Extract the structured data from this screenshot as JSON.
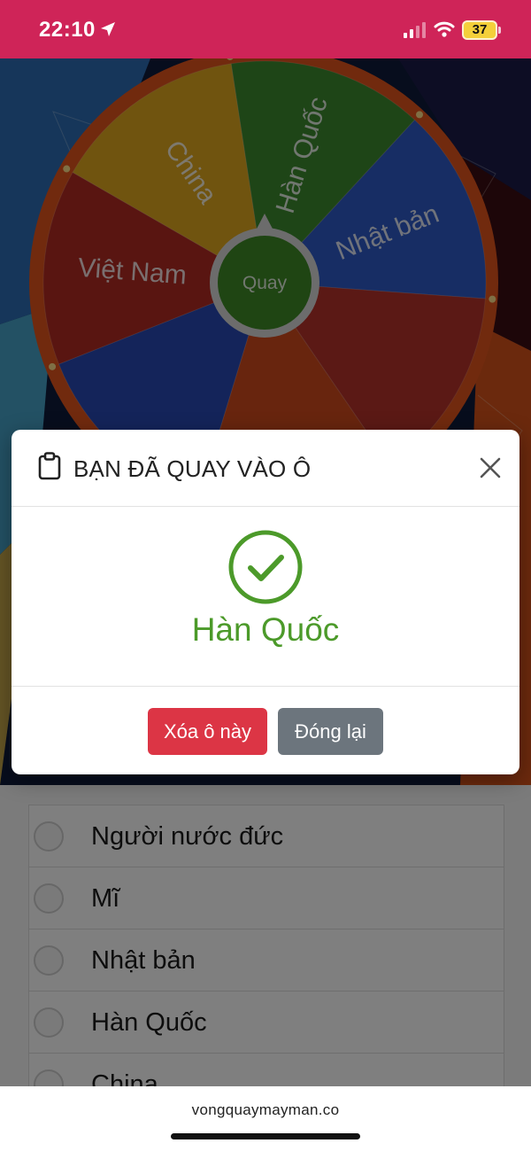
{
  "status_bar": {
    "time": "22:10",
    "location_icon": "location-arrow-icon",
    "signal_icon": "cellular-signal-icon",
    "wifi_icon": "wifi-icon",
    "battery_level": "37",
    "bar_color": "#cf2458"
  },
  "wheel": {
    "center_label": "Quay",
    "center_color": "#3f8a27",
    "pointer_icon": "pointer-triangle-icon",
    "segments": [
      {
        "label": "Hàn Quốc",
        "color": "#3d8b2f"
      },
      {
        "label": "Nhật bản",
        "color": "#2e5bc9"
      },
      {
        "label": "",
        "color": "#b7322a"
      },
      {
        "label": "",
        "color": "#d04a1c"
      },
      {
        "label": "",
        "color": "#2848b4"
      },
      {
        "label": "Việt Nam",
        "color": "#b22a22"
      },
      {
        "label": "China",
        "color": "#e1a81e"
      }
    ],
    "rim_color": "#e2541d"
  },
  "options": [
    {
      "label": "Người nước đức"
    },
    {
      "label": "Mĩ"
    },
    {
      "label": "Nhật bản"
    },
    {
      "label": "Hàn Quốc"
    },
    {
      "label": "China"
    }
  ],
  "modal": {
    "title": "BẠN ĐÃ QUAY VÀO Ô",
    "title_icon": "clipboard-icon",
    "close_icon": "close-icon",
    "success_icon": "check-circle-icon",
    "result": "Hàn Quốc",
    "result_color": "#4c9a2a",
    "delete_label": "Xóa ô này",
    "close_label": "Đóng lại"
  },
  "browser": {
    "url": "vongquaymayman.co"
  }
}
